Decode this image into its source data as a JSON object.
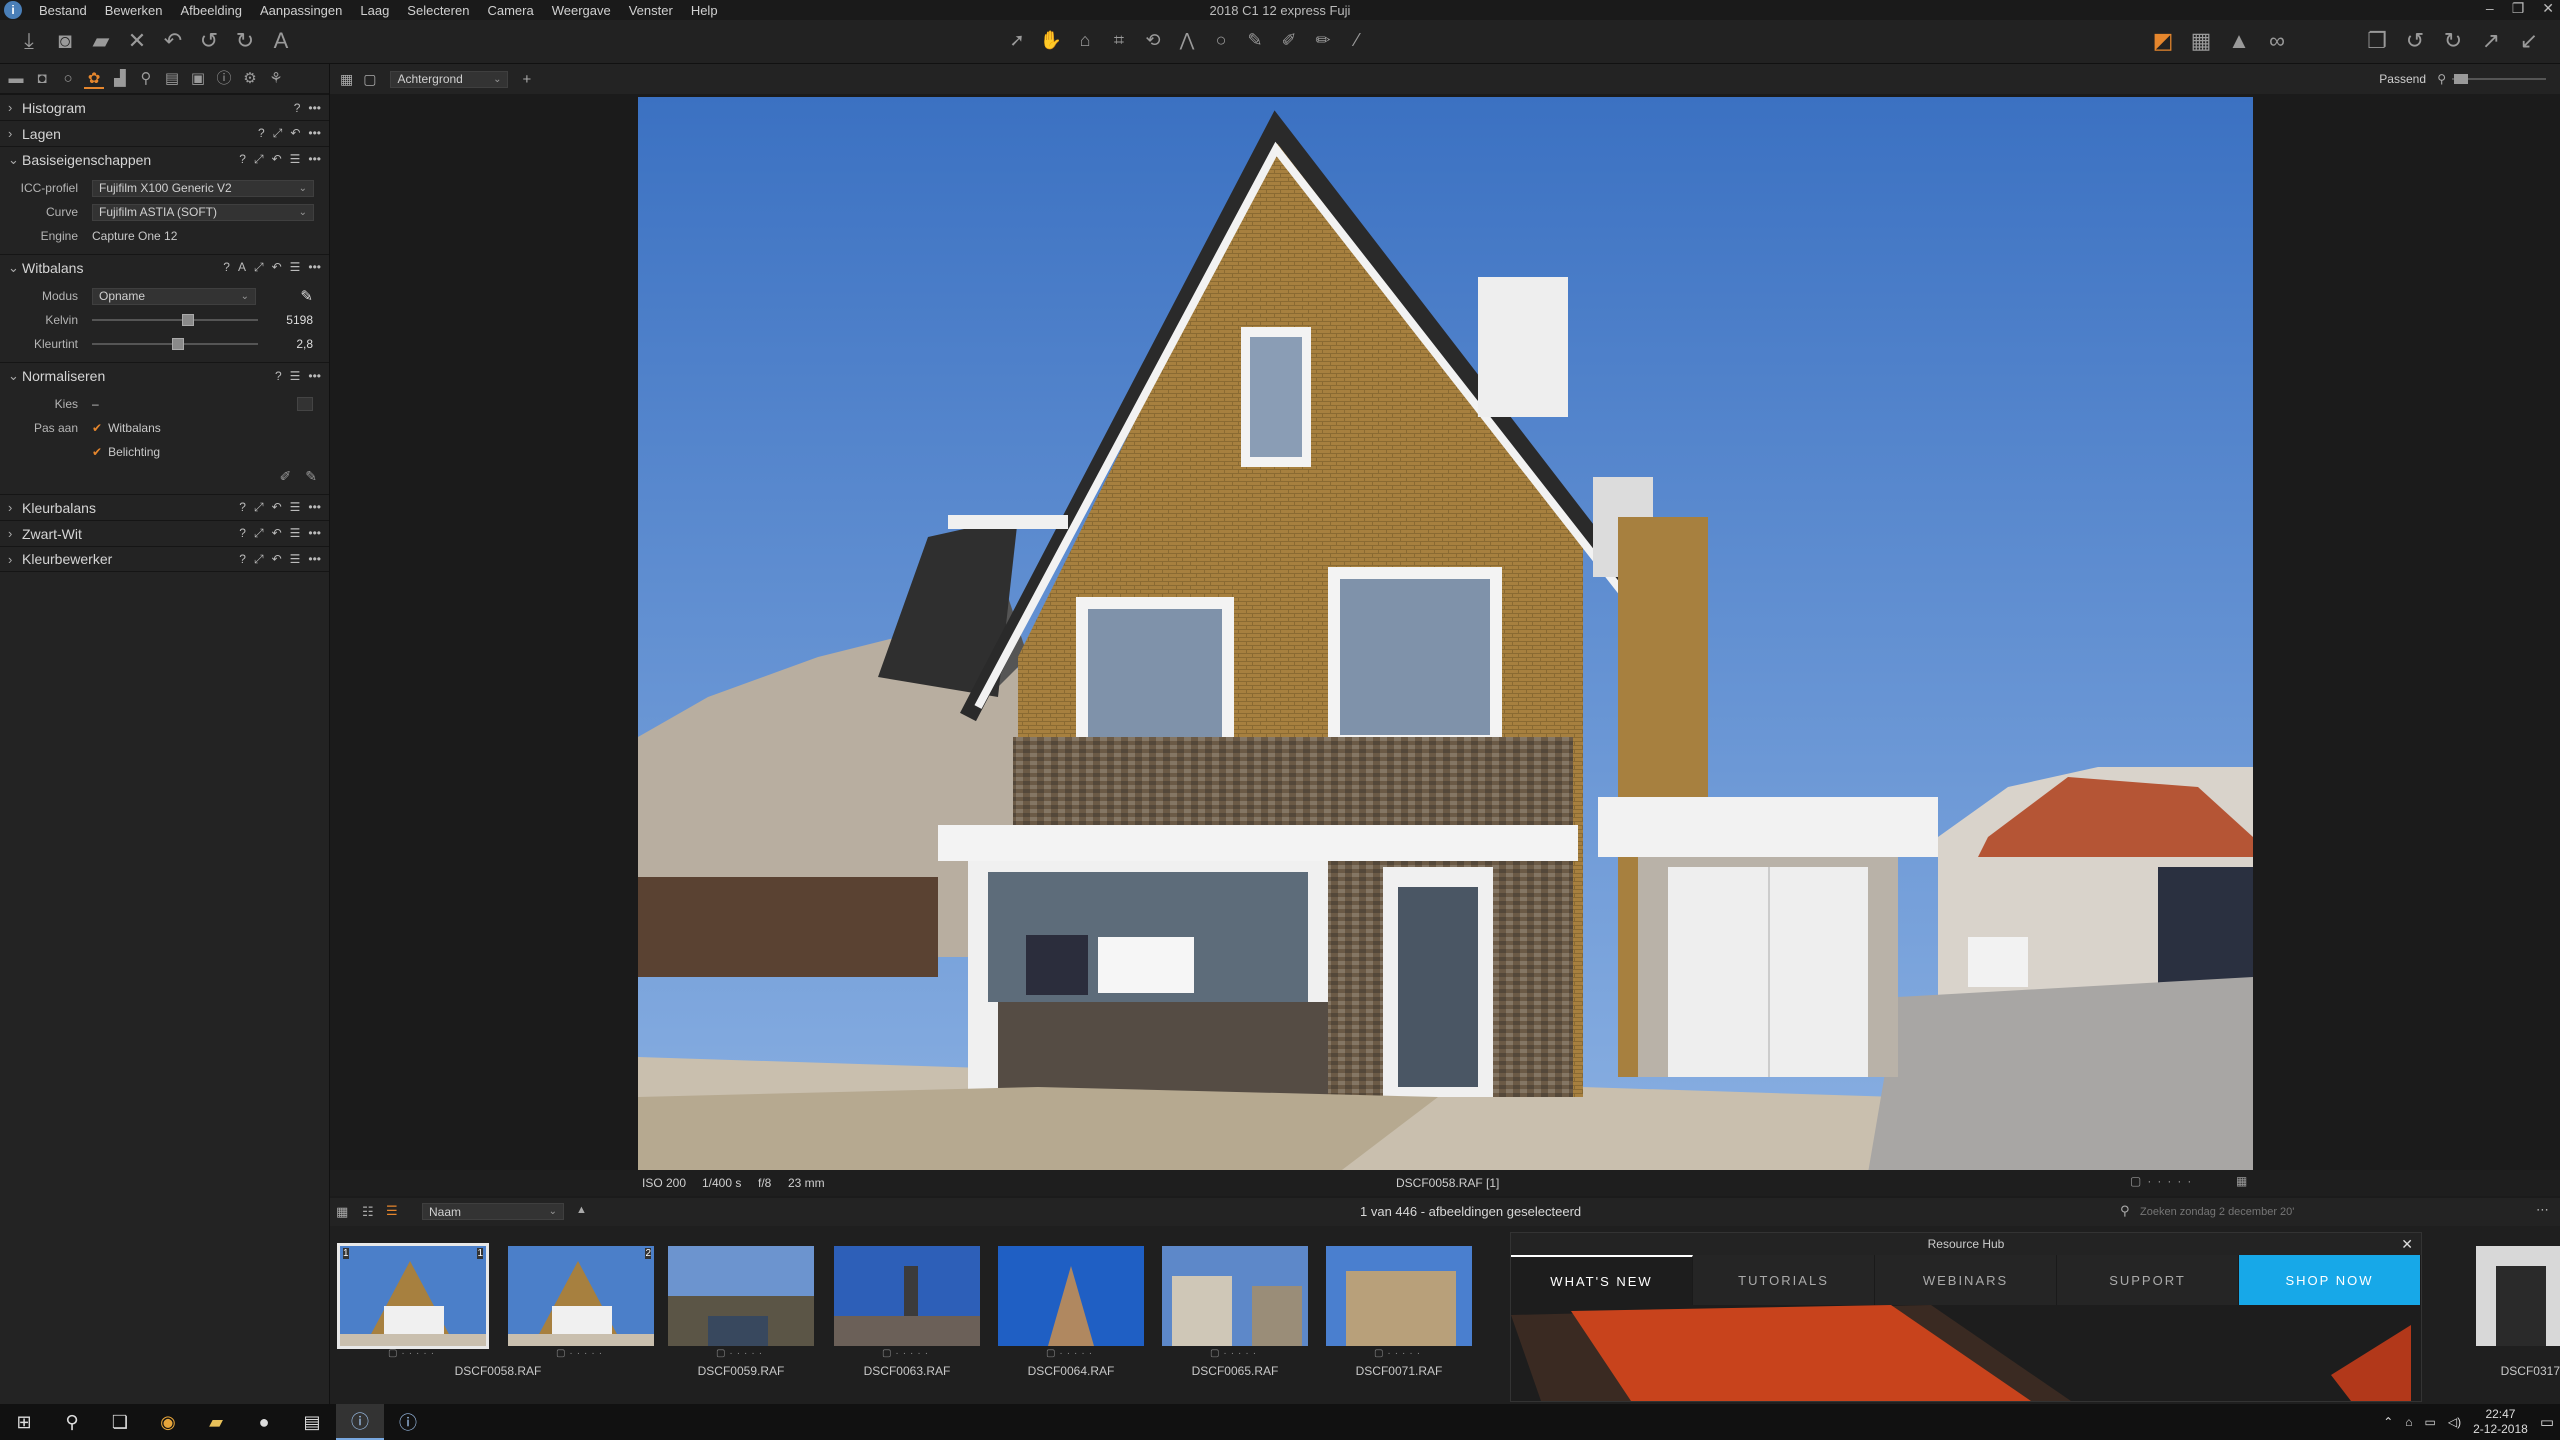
{
  "window": {
    "title": "2018 C1 12 express Fuji",
    "menu": [
      "Bestand",
      "Bewerken",
      "Afbeelding",
      "Aanpassingen",
      "Laag",
      "Selecteren",
      "Camera",
      "Weergave",
      "Venster",
      "Help"
    ],
    "controls": [
      "–",
      "❐",
      "✕"
    ]
  },
  "toolbar": {
    "left_icons": [
      "import-icon",
      "capture-icon",
      "open-folder-icon",
      "delete-icon",
      "undo-all-icon",
      "undo-icon",
      "redo-icon",
      "text-tool-icon"
    ],
    "center_icons": [
      "select-icon",
      "pan-icon",
      "crop-icon",
      "rotate-icon",
      "keystone-icon",
      "spot-icon",
      "brush-icon",
      "eraser-icon",
      "gradient-icon",
      "radial-icon",
      "picker-icon"
    ],
    "active_center": "pan-icon",
    "right_icons": [
      "exposure-warning-icon",
      "grid-icon",
      "warning-icon",
      "proof-icon"
    ],
    "far_right_icons": [
      "copy-icon",
      "reset-icon",
      "redo-arrow-icon",
      "apply-icon",
      "paste-icon"
    ]
  },
  "left_panel": {
    "tabs": [
      "library-tab",
      "capture-tab",
      "lens-tab",
      "color-tab",
      "exposure-tab",
      "details-tab",
      "local-tab",
      "adjustments-tab",
      "metadata-tab",
      "output-tab",
      "batch-tab"
    ],
    "tools": [
      {
        "name": "Histogram",
        "expanded": false
      },
      {
        "name": "Lagen",
        "expanded": false
      },
      {
        "name": "Basiseigenschappen",
        "expanded": true
      },
      {
        "name": "Witbalans",
        "expanded": true
      },
      {
        "name": "Normaliseren",
        "expanded": true
      },
      {
        "name": "Kleurbalans",
        "expanded": false
      },
      {
        "name": "Zwart-Wit",
        "expanded": false
      },
      {
        "name": "Kleurbewerker",
        "expanded": false
      }
    ],
    "basic": {
      "icc_label": "ICC-profiel",
      "icc_value": "Fujifilm X100 Generic V2",
      "curve_label": "Curve",
      "curve_value": "Fujifilm ASTIA (SOFT)",
      "engine_label": "Engine",
      "engine_value": "Capture One 12"
    },
    "white_balance": {
      "mode_label": "Modus",
      "mode_value": "Opname",
      "kelvin_label": "Kelvin",
      "kelvin_value": "5198",
      "kelvin_fraction": 0.58,
      "tint_label": "Kleurtint",
      "tint_value": "2,8",
      "tint_fraction": 0.52
    },
    "normalize": {
      "pick_label": "Kies",
      "pick_value": "–",
      "adjust_label": "Pas aan",
      "options": [
        "Witbalans",
        "Belichting"
      ]
    }
  },
  "viewer": {
    "layer_select": "Achtergrond",
    "zoom_label": "Passend",
    "info": {
      "iso": "ISO 200",
      "shutter": "1/400 s",
      "aperture": "f/8",
      "focal": "23 mm",
      "filename": "DSCF0058.RAF [1]"
    }
  },
  "browser": {
    "sort": "Naam",
    "status": "1 van 446 - afbeeldingen geselecteerd",
    "search_placeholder": "Zoeken zondag 2 december 20'",
    "thumbnails": [
      {
        "caption": "DSCF0058.RAF",
        "badge_left": "1",
        "badge_right": "1",
        "selected": true
      },
      {
        "caption": "",
        "badge_left": "",
        "badge_right": "2",
        "selected": false
      },
      {
        "caption": "DSCF0059.RAF",
        "selected": false
      },
      {
        "caption": "DSCF0063.RAF",
        "selected": false
      },
      {
        "caption": "DSCF0064.RAF",
        "selected": false
      },
      {
        "caption": "DSCF0065.RAF",
        "selected": false
      },
      {
        "caption": "DSCF0071.RAF",
        "selected": false
      },
      {
        "caption": "DSCF0317",
        "selected": false
      }
    ]
  },
  "resource_hub": {
    "title": "Resource Hub",
    "tabs": [
      "WHAT'S NEW",
      "TUTORIALS",
      "WEBINARS",
      "SUPPORT",
      "SHOP NOW"
    ]
  },
  "taskbar": {
    "time": "22:47",
    "date": "2-12-2018"
  },
  "colors": {
    "accent": "#e5862d",
    "hub_shop": "#17a8e8",
    "sky": "#4b7fc9",
    "brick": "#a7803f"
  }
}
